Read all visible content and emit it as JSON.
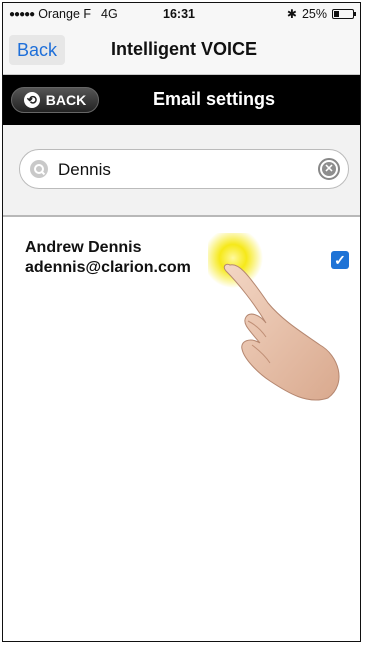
{
  "status_bar": {
    "carrier": "Orange F",
    "network": "4G",
    "time": "16:31",
    "battery_text": "25%",
    "battery_level": 0.25,
    "bluetooth_icon": "bluetooth-icon"
  },
  "nav": {
    "back_label": "Back",
    "title": "Intelligent VOICE"
  },
  "header": {
    "back_label": "BACK",
    "title": "Email settings"
  },
  "search": {
    "value": "Dennis",
    "icon": "search-icon",
    "clear_icon": "clear-icon"
  },
  "contacts": [
    {
      "name": "Andrew Dennis",
      "email": "adennis@clarion.com",
      "checked": true
    }
  ],
  "colors": {
    "accent": "#1e73d6",
    "header_bg": "#000000"
  }
}
